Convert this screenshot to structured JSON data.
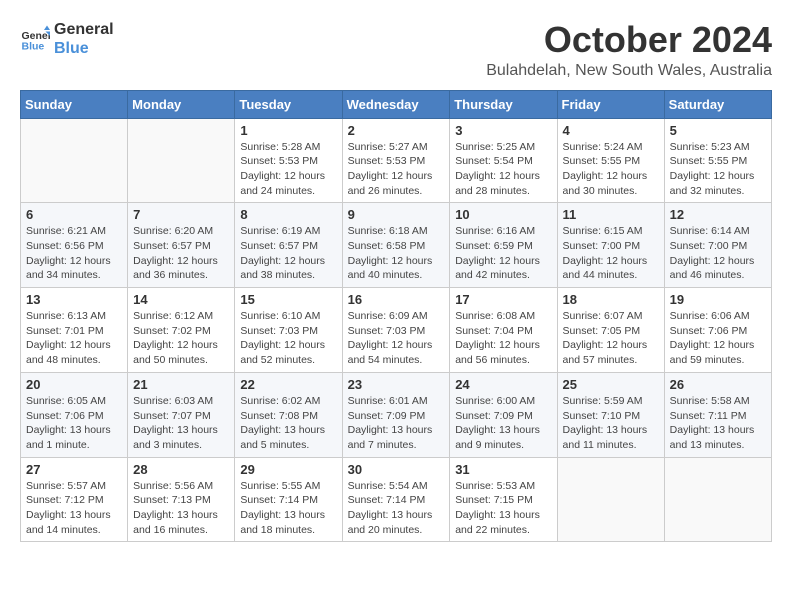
{
  "header": {
    "logo_line1": "General",
    "logo_line2": "Blue",
    "main_title": "October 2024",
    "subtitle": "Bulahdelah, New South Wales, Australia"
  },
  "calendar": {
    "weekdays": [
      "Sunday",
      "Monday",
      "Tuesday",
      "Wednesday",
      "Thursday",
      "Friday",
      "Saturday"
    ],
    "weeks": [
      [
        {
          "day": "",
          "info": ""
        },
        {
          "day": "",
          "info": ""
        },
        {
          "day": "1",
          "info": "Sunrise: 5:28 AM\nSunset: 5:53 PM\nDaylight: 12 hours\nand 24 minutes."
        },
        {
          "day": "2",
          "info": "Sunrise: 5:27 AM\nSunset: 5:53 PM\nDaylight: 12 hours\nand 26 minutes."
        },
        {
          "day": "3",
          "info": "Sunrise: 5:25 AM\nSunset: 5:54 PM\nDaylight: 12 hours\nand 28 minutes."
        },
        {
          "day": "4",
          "info": "Sunrise: 5:24 AM\nSunset: 5:55 PM\nDaylight: 12 hours\nand 30 minutes."
        },
        {
          "day": "5",
          "info": "Sunrise: 5:23 AM\nSunset: 5:55 PM\nDaylight: 12 hours\nand 32 minutes."
        }
      ],
      [
        {
          "day": "6",
          "info": "Sunrise: 6:21 AM\nSunset: 6:56 PM\nDaylight: 12 hours\nand 34 minutes."
        },
        {
          "day": "7",
          "info": "Sunrise: 6:20 AM\nSunset: 6:57 PM\nDaylight: 12 hours\nand 36 minutes."
        },
        {
          "day": "8",
          "info": "Sunrise: 6:19 AM\nSunset: 6:57 PM\nDaylight: 12 hours\nand 38 minutes."
        },
        {
          "day": "9",
          "info": "Sunrise: 6:18 AM\nSunset: 6:58 PM\nDaylight: 12 hours\nand 40 minutes."
        },
        {
          "day": "10",
          "info": "Sunrise: 6:16 AM\nSunset: 6:59 PM\nDaylight: 12 hours\nand 42 minutes."
        },
        {
          "day": "11",
          "info": "Sunrise: 6:15 AM\nSunset: 7:00 PM\nDaylight: 12 hours\nand 44 minutes."
        },
        {
          "day": "12",
          "info": "Sunrise: 6:14 AM\nSunset: 7:00 PM\nDaylight: 12 hours\nand 46 minutes."
        }
      ],
      [
        {
          "day": "13",
          "info": "Sunrise: 6:13 AM\nSunset: 7:01 PM\nDaylight: 12 hours\nand 48 minutes."
        },
        {
          "day": "14",
          "info": "Sunrise: 6:12 AM\nSunset: 7:02 PM\nDaylight: 12 hours\nand 50 minutes."
        },
        {
          "day": "15",
          "info": "Sunrise: 6:10 AM\nSunset: 7:03 PM\nDaylight: 12 hours\nand 52 minutes."
        },
        {
          "day": "16",
          "info": "Sunrise: 6:09 AM\nSunset: 7:03 PM\nDaylight: 12 hours\nand 54 minutes."
        },
        {
          "day": "17",
          "info": "Sunrise: 6:08 AM\nSunset: 7:04 PM\nDaylight: 12 hours\nand 56 minutes."
        },
        {
          "day": "18",
          "info": "Sunrise: 6:07 AM\nSunset: 7:05 PM\nDaylight: 12 hours\nand 57 minutes."
        },
        {
          "day": "19",
          "info": "Sunrise: 6:06 AM\nSunset: 7:06 PM\nDaylight: 12 hours\nand 59 minutes."
        }
      ],
      [
        {
          "day": "20",
          "info": "Sunrise: 6:05 AM\nSunset: 7:06 PM\nDaylight: 13 hours\nand 1 minute."
        },
        {
          "day": "21",
          "info": "Sunrise: 6:03 AM\nSunset: 7:07 PM\nDaylight: 13 hours\nand 3 minutes."
        },
        {
          "day": "22",
          "info": "Sunrise: 6:02 AM\nSunset: 7:08 PM\nDaylight: 13 hours\nand 5 minutes."
        },
        {
          "day": "23",
          "info": "Sunrise: 6:01 AM\nSunset: 7:09 PM\nDaylight: 13 hours\nand 7 minutes."
        },
        {
          "day": "24",
          "info": "Sunrise: 6:00 AM\nSunset: 7:09 PM\nDaylight: 13 hours\nand 9 minutes."
        },
        {
          "day": "25",
          "info": "Sunrise: 5:59 AM\nSunset: 7:10 PM\nDaylight: 13 hours\nand 11 minutes."
        },
        {
          "day": "26",
          "info": "Sunrise: 5:58 AM\nSunset: 7:11 PM\nDaylight: 13 hours\nand 13 minutes."
        }
      ],
      [
        {
          "day": "27",
          "info": "Sunrise: 5:57 AM\nSunset: 7:12 PM\nDaylight: 13 hours\nand 14 minutes."
        },
        {
          "day": "28",
          "info": "Sunrise: 5:56 AM\nSunset: 7:13 PM\nDaylight: 13 hours\nand 16 minutes."
        },
        {
          "day": "29",
          "info": "Sunrise: 5:55 AM\nSunset: 7:14 PM\nDaylight: 13 hours\nand 18 minutes."
        },
        {
          "day": "30",
          "info": "Sunrise: 5:54 AM\nSunset: 7:14 PM\nDaylight: 13 hours\nand 20 minutes."
        },
        {
          "day": "31",
          "info": "Sunrise: 5:53 AM\nSunset: 7:15 PM\nDaylight: 13 hours\nand 22 minutes."
        },
        {
          "day": "",
          "info": ""
        },
        {
          "day": "",
          "info": ""
        }
      ]
    ]
  }
}
